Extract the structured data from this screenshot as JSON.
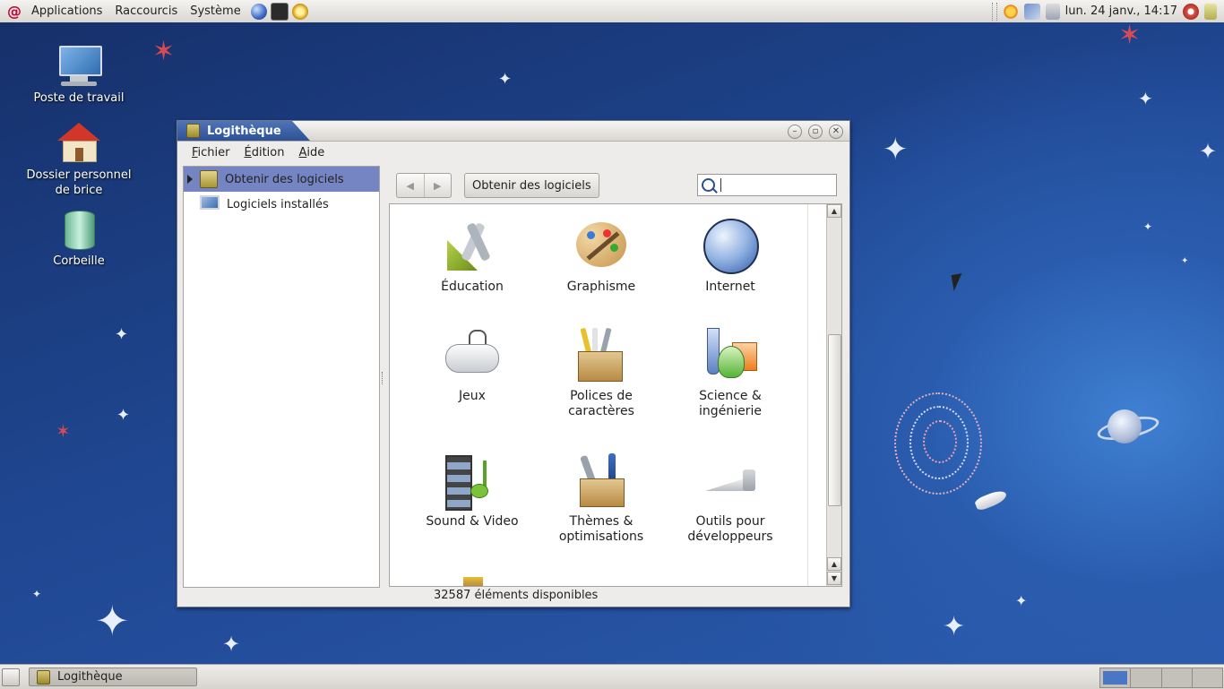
{
  "top_panel": {
    "menus": [
      "Applications",
      "Raccourcis",
      "Système"
    ],
    "launchers": [
      "web-browser-icon",
      "terminal-icon",
      "help-icon"
    ],
    "clock": "lun. 24 janv., 14:17"
  },
  "desktop": {
    "icons": [
      {
        "label": "Poste de travail"
      },
      {
        "label": "Dossier personnel\nde brice"
      },
      {
        "label": "Corbeille"
      }
    ]
  },
  "window": {
    "title": "Logithèque",
    "menus": [
      {
        "underline": "F",
        "rest": "ichier"
      },
      {
        "underline": "É",
        "rest": "dition"
      },
      {
        "underline": "A",
        "rest": "ide"
      }
    ],
    "sidebar": {
      "items": [
        {
          "label": "Obtenir des logiciels",
          "selected": true
        },
        {
          "label": "Logiciels installés",
          "selected": false
        }
      ]
    },
    "toolbar": {
      "breadcrumb": "Obtenir des logiciels",
      "search_value": ""
    },
    "categories": [
      {
        "label": "Éducation",
        "icon": "education-icon"
      },
      {
        "label": "Graphisme",
        "icon": "graphics-icon"
      },
      {
        "label": "Internet",
        "icon": "internet-icon"
      },
      {
        "label": "Jeux",
        "icon": "games-icon"
      },
      {
        "label": "Polices de\ncaractères",
        "icon": "fonts-icon"
      },
      {
        "label": "Science &\ningénierie",
        "icon": "science-icon"
      },
      {
        "label": "Sound & Video",
        "icon": "sound-video-icon"
      },
      {
        "label": "Thèmes &\noptimisations",
        "icon": "themes-icon"
      },
      {
        "label": "Outils pour\ndéveloppeurs",
        "icon": "developer-tools-icon"
      }
    ],
    "status": "32587 éléments disponibles"
  },
  "taskbar": {
    "tasks": [
      {
        "label": "Logithèque"
      }
    ],
    "workspaces_count": 4,
    "active_workspace": 1
  },
  "colors": {
    "selection": "#7584c2",
    "title_active": "#2d5195",
    "desktop": "#1d3f80"
  }
}
